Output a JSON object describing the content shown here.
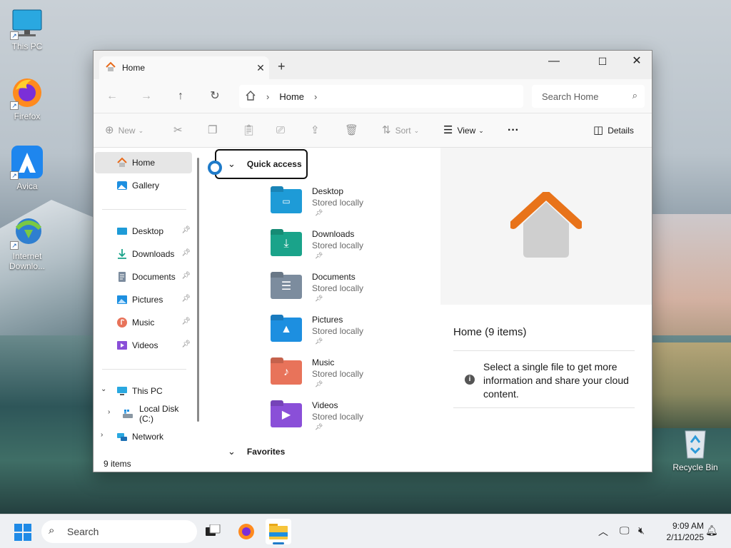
{
  "desktop": {
    "icons": [
      {
        "label": "This PC",
        "icon": "monitor-icon"
      },
      {
        "label": "Firefox",
        "icon": "firefox-icon"
      },
      {
        "label": "Avica",
        "icon": "avica-icon"
      },
      {
        "label": "Internet Downlo...",
        "icon": "idm-icon"
      },
      {
        "label": "Recycle Bin",
        "icon": "recycle-bin-icon"
      }
    ]
  },
  "window": {
    "tab_title": "Home",
    "controls": {
      "minimize": "—",
      "maximize": "☐",
      "close": "✕"
    },
    "address": {
      "crumbs": [
        "Home"
      ]
    },
    "search_placeholder": "Search Home",
    "toolbar": {
      "new_label": "New",
      "sort_label": "Sort",
      "view_label": "View",
      "more_label": "···",
      "details_label": "Details"
    },
    "navpane": {
      "top": [
        {
          "label": "Home",
          "icon": "home-icon",
          "selected": true
        },
        {
          "label": "Gallery",
          "icon": "gallery-icon"
        }
      ],
      "pinned": [
        {
          "label": "Desktop",
          "icon": "desktop-folder-icon"
        },
        {
          "label": "Downloads",
          "icon": "download-icon"
        },
        {
          "label": "Documents",
          "icon": "documents-icon"
        },
        {
          "label": "Pictures",
          "icon": "pictures-icon"
        },
        {
          "label": "Music",
          "icon": "music-icon"
        },
        {
          "label": "Videos",
          "icon": "videos-icon"
        }
      ],
      "tree": [
        {
          "label": "This PC",
          "icon": "pc-icon",
          "expanded": true
        },
        {
          "label": "Local Disk (C:)",
          "icon": "drive-icon"
        },
        {
          "label": "Network",
          "icon": "network-icon"
        }
      ]
    },
    "main": {
      "quick_access_label": "Quick access",
      "folders": [
        {
          "name": "Desktop",
          "status": "Stored locally",
          "color": "#1e9bd7"
        },
        {
          "name": "Downloads",
          "status": "Stored locally",
          "color": "#1aa38a"
        },
        {
          "name": "Documents",
          "status": "Stored locally",
          "color": "#7c8c9e"
        },
        {
          "name": "Pictures",
          "status": "Stored locally",
          "color": "#1d8fe0"
        },
        {
          "name": "Music",
          "status": "Stored locally",
          "color": "#e8735a"
        },
        {
          "name": "Videos",
          "status": "Stored locally",
          "color": "#8a4fd8"
        }
      ],
      "favorites_label": "Favorites"
    },
    "preview": {
      "title": "Home (9 items)",
      "info": "Select a single file to get more information and share your cloud content."
    },
    "status": "9 items"
  },
  "taskbar": {
    "search_placeholder": "Search",
    "time": "9:09 AM",
    "date": "2/11/2025"
  }
}
